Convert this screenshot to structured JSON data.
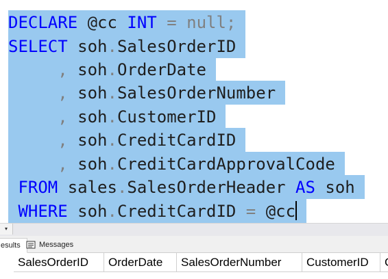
{
  "editor": {
    "lines": [
      [
        {
          "t": "DECLARE",
          "c": "kw"
        },
        {
          "t": " @cc ",
          "c": "tx"
        },
        {
          "t": "INT",
          "c": "kw"
        },
        {
          "t": " = null;",
          "c": "gy"
        }
      ],
      [
        {
          "t": "SELECT",
          "c": "kw"
        },
        {
          "t": " soh",
          "c": "tx"
        },
        {
          "t": ".",
          "c": "gy"
        },
        {
          "t": "SalesOrderID",
          "c": "tx"
        }
      ],
      [
        {
          "t": "     ,",
          "c": "gy"
        },
        {
          "t": " soh",
          "c": "tx"
        },
        {
          "t": ".",
          "c": "gy"
        },
        {
          "t": "OrderDate",
          "c": "tx"
        }
      ],
      [
        {
          "t": "     ,",
          "c": "gy"
        },
        {
          "t": " soh",
          "c": "tx"
        },
        {
          "t": ".",
          "c": "gy"
        },
        {
          "t": "SalesOrderNumber",
          "c": "tx"
        }
      ],
      [
        {
          "t": "     ,",
          "c": "gy"
        },
        {
          "t": " soh",
          "c": "tx"
        },
        {
          "t": ".",
          "c": "gy"
        },
        {
          "t": "CustomerID",
          "c": "tx"
        }
      ],
      [
        {
          "t": "     ,",
          "c": "gy"
        },
        {
          "t": " soh",
          "c": "tx"
        },
        {
          "t": ".",
          "c": "gy"
        },
        {
          "t": "CreditCardID",
          "c": "tx"
        }
      ],
      [
        {
          "t": "     ,",
          "c": "gy"
        },
        {
          "t": " soh",
          "c": "tx"
        },
        {
          "t": ".",
          "c": "gy"
        },
        {
          "t": "CreditCardApprovalCode",
          "c": "tx"
        }
      ],
      [
        {
          "t": " FROM",
          "c": "kw"
        },
        {
          "t": " sales",
          "c": "tx"
        },
        {
          "t": ".",
          "c": "gy"
        },
        {
          "t": "SalesOrderHeader ",
          "c": "tx"
        },
        {
          "t": "AS",
          "c": "kw"
        },
        {
          "t": " soh",
          "c": "tx"
        }
      ],
      [
        {
          "t": " WHERE",
          "c": "kw"
        },
        {
          "t": " soh",
          "c": "tx"
        },
        {
          "t": ".",
          "c": "gy"
        },
        {
          "t": "CreditCardID ",
          "c": "tx"
        },
        {
          "t": "=",
          "c": "gy"
        },
        {
          "t": " @cc",
          "c": "tx"
        }
      ]
    ],
    "colors": {
      "keyword": "#0000ff",
      "operator": "#808080",
      "identifier": "#1e1e1e",
      "selection": "#99c9ef"
    }
  },
  "zoom_dropdown": {
    "icon": "chevron-down-icon"
  },
  "tabs": {
    "results_label": "esults",
    "messages_label": "Messages",
    "messages_icon": "messages-icon"
  },
  "grid": {
    "columns": [
      "SalesOrderID",
      "OrderDate",
      "SalesOrderNumber",
      "CustomerID",
      "C"
    ]
  }
}
